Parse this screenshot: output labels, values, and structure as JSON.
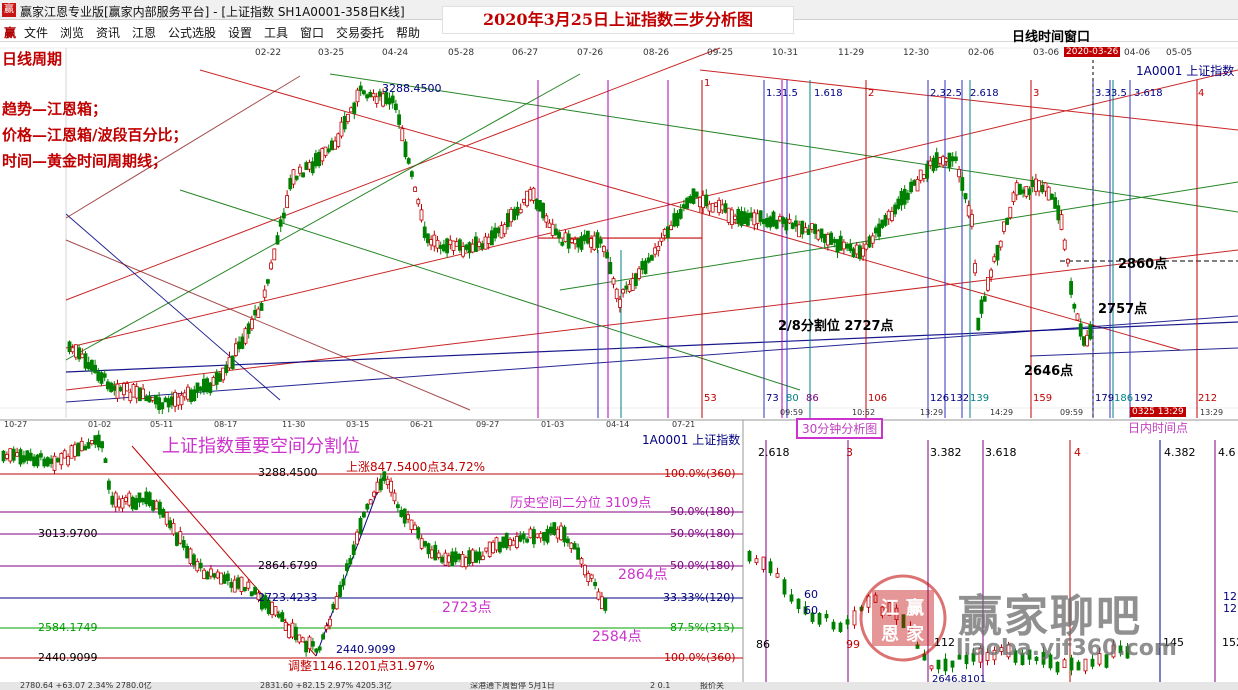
{
  "window": {
    "title": "赢家江恩专业版[赢家内部服务平台] - [上证指数  SH1A0001-358日K线]",
    "icon": "赢"
  },
  "menu": {
    "logo": "赢",
    "items": [
      "文件",
      "浏览",
      "资讯",
      "江恩",
      "公式选股",
      "设置",
      "工具",
      "窗口",
      "交易委托",
      "帮助"
    ]
  },
  "headline": "2020年3月25日上证指数三步分析图",
  "daily": {
    "window_label": "日线时间窗口",
    "period_label": "日线周期",
    "method_lines": [
      "趋势—江恩箱；",
      "价格—江恩箱/波段百分比；",
      "时间—黄金时间周期线；"
    ],
    "symbol": "1A0001  上证指数",
    "top_dates": [
      "02-22",
      "03-25",
      "04-24",
      "05-28",
      "06-27",
      "07-26",
      "08-26",
      "09-25",
      "10-31",
      "11-29",
      "12-30",
      "02-06",
      "03-06",
      "2020-03-26",
      "04-06",
      "05-05"
    ],
    "bottom_dates": [
      "10-27",
      "01-02",
      "05-11",
      "08-17",
      "11-30",
      "03-15",
      "06-21",
      "09-27",
      "01-03",
      "04-14",
      "07-21",
      "09:59",
      "10:52",
      "13:29",
      "14:29",
      "09:59",
      "13:29"
    ],
    "bottom_active": "0325 13:29",
    "high_label": "3288.4500",
    "fib_labels": [
      "1",
      "1.31.5",
      "1.618",
      "2",
      "2.32.5",
      "2.618",
      "3",
      "3.33.5",
      "3.618",
      "4"
    ],
    "count_labels": [
      "53",
      "73",
      "80",
      "86",
      "106",
      "126",
      "132",
      "139",
      "159",
      "179",
      "186",
      "192",
      "212"
    ],
    "points": {
      "p2860": "2860点",
      "p2757": "2757点",
      "split": "2/8分割位  2727点",
      "p2646": "2646点"
    }
  },
  "space": {
    "title": "上证指数重要空间分割位",
    "symbol": "1A0001  上证指数",
    "rise_label": "上涨847.5400点34.72%",
    "adjust_label": "调整1146.1201点31.97%",
    "history_label": "历史空间二分位  3109点",
    "left_prices": [
      "3288.4500",
      "3013.9700",
      "2864.6799",
      "2723.4233",
      "2584.1749",
      "2440.9099"
    ],
    "low_label": "2440.9099",
    "right_levels": [
      "100.0%(360)",
      "50.0%(180)",
      "50.0%(180)",
      "50.0%(180)",
      "33.33%(120)",
      "87.5%(315)",
      "100.0%(360)"
    ],
    "points": {
      "p2864": "2864点",
      "p2723": "2723点",
      "p2584": "2584点"
    }
  },
  "intraday": {
    "title": "30分钟分析图",
    "window_label": "日内时间点",
    "fib_labels": [
      "2.618",
      "3",
      "3.382",
      "3.618",
      "4",
      "4.382",
      "4.6"
    ],
    "numbers": [
      "60",
      "60",
      "86",
      "99",
      "112",
      "135",
      "145",
      "152",
      "12",
      "12"
    ],
    "low_label": "2646.8101"
  },
  "watermark": {
    "seal": [
      "江",
      "赢",
      "恩",
      "家"
    ],
    "text": "赢家聊吧",
    "url": "liaoba.yjf360.com"
  },
  "status": {
    "items": [
      "2780.64 +63.07  2.34%  2780.0亿",
      "2831.60 +82.15  2.97%  4205.3亿",
      "深港通下周暂停 5月1日",
      "2  0.1",
      "报价关"
    ]
  },
  "colors": {
    "red": "#c00000",
    "navy": "#000080",
    "purple": "#800080",
    "magenta": "#c040c0",
    "green": "#00a000",
    "candle_up": "#c00000",
    "candle_down": "#008000",
    "highlight": "#cc33cc"
  }
}
